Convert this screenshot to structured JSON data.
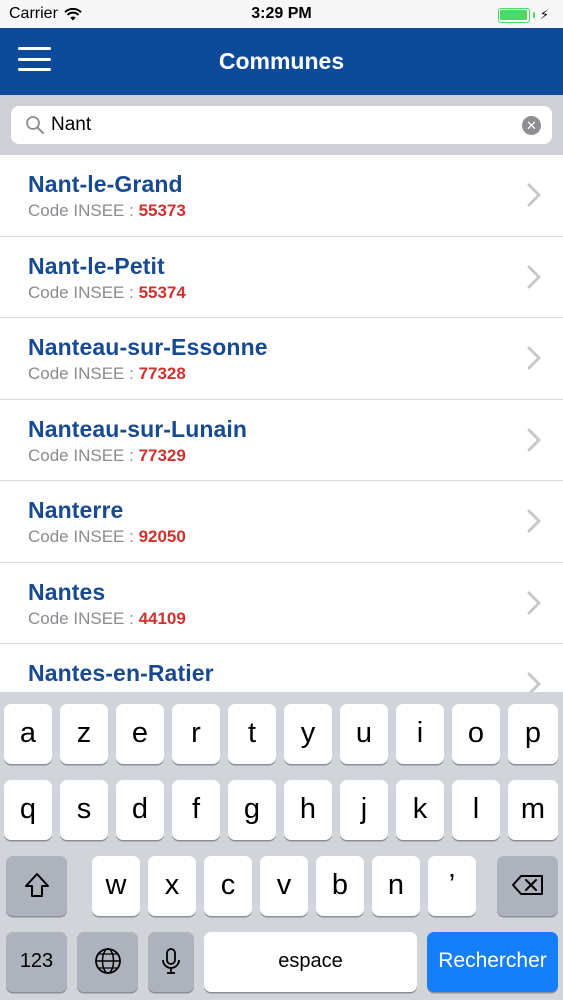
{
  "status_bar": {
    "carrier": "Carrier",
    "time": "3:29 PM"
  },
  "nav": {
    "title": "Communes",
    "menu_icon": "hamburger-menu-icon"
  },
  "search": {
    "value": "Nant",
    "placeholder": ""
  },
  "list": {
    "code_label": "Code INSEE : ",
    "items": [
      {
        "name": "Nant-le-Grand",
        "code": "55373"
      },
      {
        "name": "Nant-le-Petit",
        "code": "55374"
      },
      {
        "name": "Nanteau-sur-Essonne",
        "code": "77328"
      },
      {
        "name": "Nanteau-sur-Lunain",
        "code": "77329"
      },
      {
        "name": "Nanterre",
        "code": "92050"
      },
      {
        "name": "Nantes",
        "code": "44109"
      },
      {
        "name": "Nantes-en-Ratier",
        "code": ""
      }
    ]
  },
  "keyboard": {
    "row1": [
      "a",
      "z",
      "e",
      "r",
      "t",
      "y",
      "u",
      "i",
      "o",
      "p"
    ],
    "row2": [
      "q",
      "s",
      "d",
      "f",
      "g",
      "h",
      "j",
      "k",
      "l",
      "m"
    ],
    "row3": [
      "w",
      "x",
      "c",
      "v",
      "b",
      "n",
      "’"
    ],
    "numbers_label": "123",
    "space_label": "espace",
    "search_label": "Rechercher"
  },
  "colors": {
    "nav": "#0e4a9a",
    "name": "#174a91",
    "code": "#d0312d",
    "search_key": "#157efb"
  }
}
